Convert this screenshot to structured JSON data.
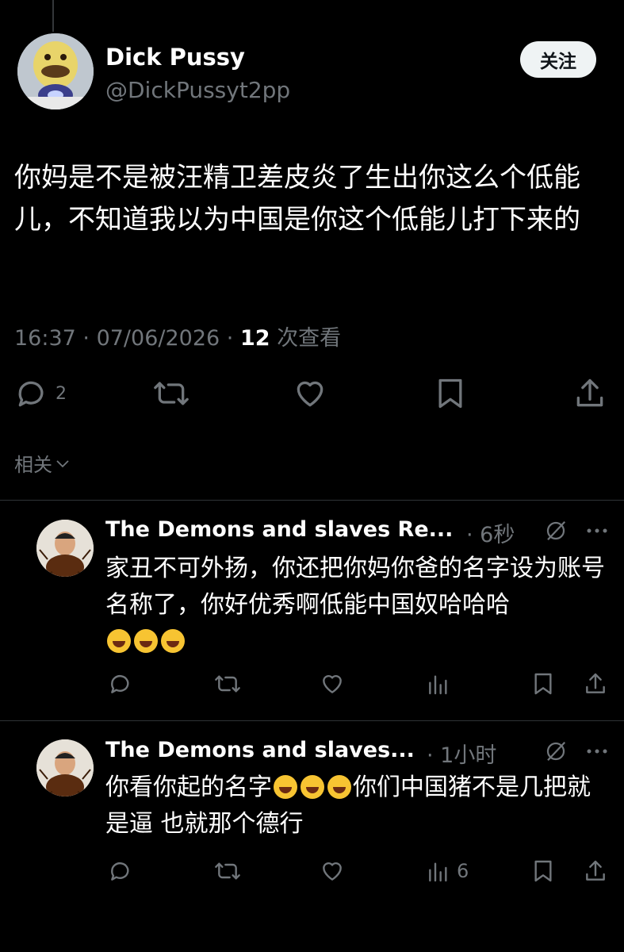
{
  "post": {
    "author_name": "Dick Pussy",
    "author_handle": "@DickPussyt2pp",
    "follow_label": "关注",
    "text": "你妈是不是被汪精卫差皮炎了生出你这么个低能儿，不知道我以为中国是你这个低能儿打下来的",
    "time": "16:37",
    "date": "07/06/2026",
    "views_count": "12",
    "views_label": "次查看",
    "reply_count": "2",
    "icons": [
      "reply-icon",
      "retweet-icon",
      "like-icon",
      "bookmark-icon",
      "share-icon"
    ]
  },
  "related_label": "相关",
  "replies": [
    {
      "author_name": "The Demons and slaves Re...",
      "time": "6秒",
      "text": "家丑不可外扬，你还把你妈你爸的名字设为账号名称了，你好优秀啊低能中国奴哈哈哈",
      "emojis": [
        "grinning-emoji",
        "rofl-emoji",
        "joy-emoji"
      ],
      "views_count": ""
    },
    {
      "author_name": "The Demons and slaves...",
      "time": "1小时",
      "text_before": "你看你起的名字",
      "emojis": [
        "joy-emoji",
        "rofl-emoji",
        "rofl-emoji"
      ],
      "text_after": "你们中国猪不是几把就是逼 也就那个德行",
      "views_count": "6"
    }
  ],
  "colors": {
    "background": "#000000",
    "text": "#e7e9ea",
    "muted": "#71767b",
    "divider": "#2f3336",
    "button_bg": "#eff3f4"
  }
}
